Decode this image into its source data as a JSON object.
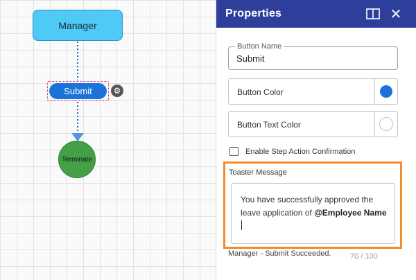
{
  "canvas": {
    "nodes": {
      "manager": "Manager",
      "submit": "Submit",
      "terminate": "Terminate"
    },
    "gear_icon": "gear-icon"
  },
  "panel": {
    "title": "Properties",
    "dock_icon": "dock-panel-icon",
    "close_icon": "close-icon",
    "button_name": {
      "label": "Button Name",
      "value": "Submit"
    },
    "button_color": {
      "label": "Button Color",
      "color": "#1a73d9"
    },
    "button_text_color": {
      "label": "Button Text Color",
      "color": "#ffffff"
    },
    "confirm": {
      "label": "Enable Step Action Confirmation",
      "checked": false
    },
    "toaster": {
      "label": "Toaster Message",
      "text": "You have successfully approved the leave application of ",
      "variable": "@Employee Name"
    },
    "status_message": "Manager - Submit Succeeded.",
    "char_count": "70 / 100"
  },
  "colors": {
    "header_bg": "#2e3f9b",
    "highlight": "#f58a2e",
    "manager_node": "#4fc9f5",
    "submit_node": "#1a73d9",
    "terminate_node": "#43a047"
  }
}
